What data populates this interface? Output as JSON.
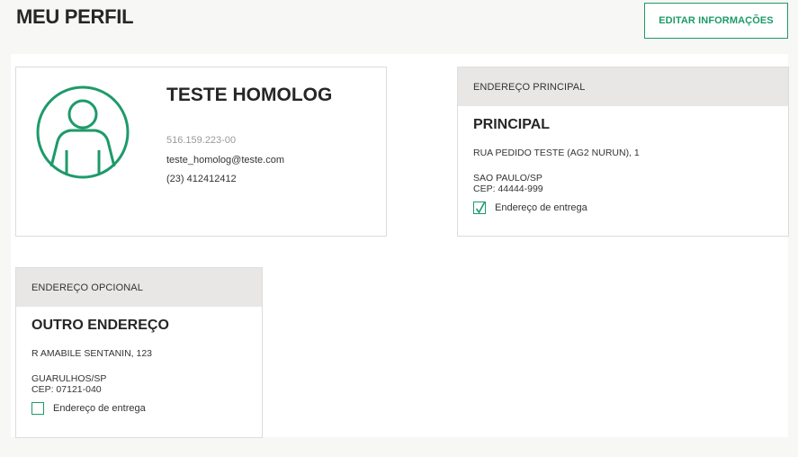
{
  "header": {
    "title": "MEU PERFIL",
    "edit_label": "EDITAR INFORMAÇÕES"
  },
  "profile": {
    "name": "TESTE HOMOLOG",
    "cpf": "516.159.223-00",
    "email": "teste_homolog@teste.com",
    "phone": "(23) 412412412",
    "avatar_icon": "user-avatar-icon"
  },
  "addresses": [
    {
      "header": "ENDEREÇO PRINCIPAL",
      "title": "PRINCIPAL",
      "street": "RUA PEDIDO TESTE (AG2 NURUN), 1",
      "city": "SAO PAULO/SP",
      "cep": "CEP: 44444-999",
      "delivery_label": "Endereço de entrega",
      "delivery_checked": true
    },
    {
      "header": "ENDEREÇO OPCIONAL",
      "title": "OUTRO ENDEREÇO",
      "street": "R AMABILE SENTANIN, 123",
      "city": "GUARULHOS/SP",
      "cep": "CEP: 07121-040",
      "delivery_label": "Endereço de entrega",
      "delivery_checked": false
    }
  ],
  "colors": {
    "accent": "#1e9a6a",
    "header_bg": "#e8e7e5",
    "page_bg": "#f7f7f5"
  }
}
